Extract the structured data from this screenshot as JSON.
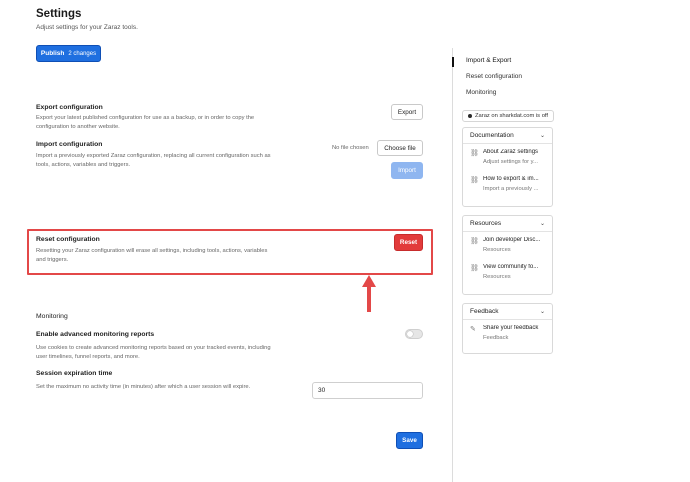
{
  "page": {
    "title": "Settings",
    "subtitle": "Adjust settings for your Zaraz tools."
  },
  "publish": {
    "label": "Publish",
    "changes": "2 changes"
  },
  "export": {
    "title": "Export configuration",
    "desc_line1": "Export your latest published configuration for use as a backup, or in order to copy the",
    "desc_line2": "configuration to another website.",
    "button": "Export"
  },
  "import": {
    "title": "Import configuration",
    "desc_line1": "Import a previously exported Zaraz configuration, replacing all current configuration such as",
    "desc_line2": "tools, actions, variables and triggers.",
    "no_file": "No file chosen",
    "choose_button": "Choose file",
    "import_button": "Import"
  },
  "reset": {
    "title": "Reset configuration",
    "desc_line1": "Resetting your Zaraz configuration will erase all settings, including tools, actions, variables",
    "desc_line2": "and triggers.",
    "button": "Reset"
  },
  "monitoring": {
    "section_title": "Monitoring",
    "toggle_title": "Enable advanced monitoring reports",
    "toggle_desc_line1": "Use cookies to create advanced monitoring reports based on your tracked events, including",
    "toggle_desc_line2": "user timelines, funnel reports, and more.",
    "toggle_on": false,
    "session_title": "Session expiration time",
    "session_desc": "Set the maximum no activity time (in minutes) after which a user session will expire.",
    "session_value": "30",
    "save_button": "Save"
  },
  "sidebar": {
    "nav": [
      "Import & Export",
      "Reset configuration",
      "Monitoring"
    ],
    "zaraz_status": "Zaraz on sharkdat.com is off",
    "cards": [
      {
        "title": "Documentation",
        "items": [
          {
            "title": "About Zaraz settings",
            "sub": "Adjust settings for y..."
          },
          {
            "title": "How to export & im...",
            "sub": "Import a previously ..."
          }
        ]
      },
      {
        "title": "Resources",
        "items": [
          {
            "title": "Join developer Disc...",
            "sub": "Resources"
          },
          {
            "title": "View community fo...",
            "sub": "Resources"
          }
        ]
      },
      {
        "title": "Feedback",
        "items": [
          {
            "title": "Share your feedback",
            "sub": "Feedback"
          }
        ]
      }
    ]
  },
  "colors": {
    "primary": "#1f6fe0",
    "danger": "#e23b3b",
    "annotation": "#e34848"
  }
}
